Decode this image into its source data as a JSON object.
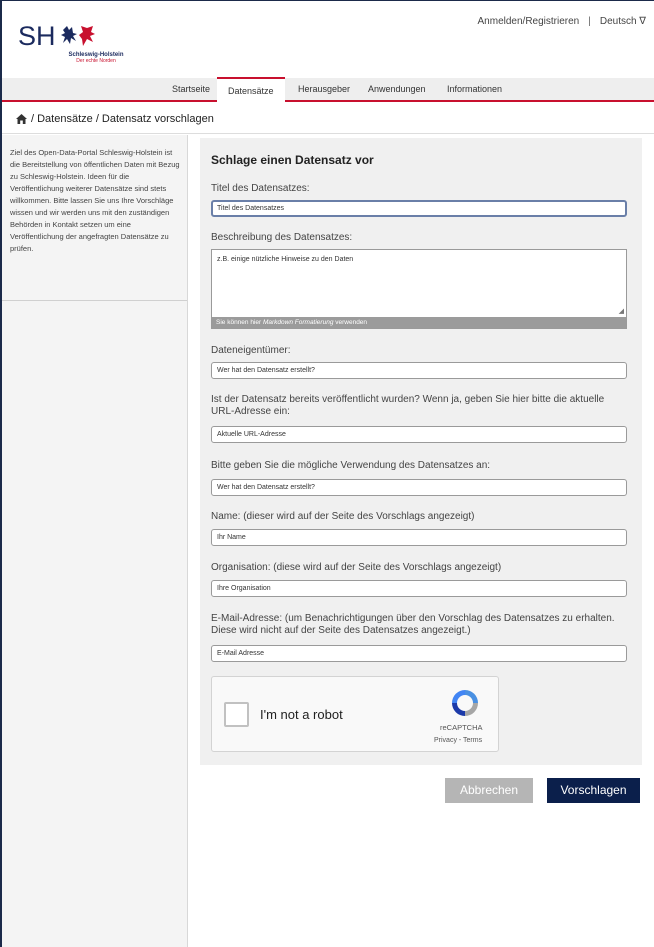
{
  "colors": {
    "brand_navy": "#0b1f4b",
    "accent_red": "#c8102e",
    "cancel_gray": "#b5b5b5"
  },
  "logo": {
    "initials": "SH",
    "name": "Schleswig-Holstein",
    "tagline": "Der echte Norden",
    "icon": "coat-of-arms-icon"
  },
  "topnav": {
    "login": "Anmelden/Registrieren",
    "separator": "|",
    "language": "Deutsch ∇"
  },
  "mainnav": [
    "Startseite",
    "Datensätze",
    "Herausgeber",
    "Anwendungen",
    "Informationen"
  ],
  "breadcrumb": {
    "icon": "home-icon",
    "text": "/ Datensätze / Datensatz vorschlagen"
  },
  "sidebar": {
    "text": "Ziel des Open-Data-Portal Schleswig-Holstein ist die Bereitstellung von öffentlichen Daten mit Bezug zu Schleswig-Holstein. Ideen für die Veröffentlichung weiterer Datensätze sind stets willkommen. Bitte lassen Sie uns Ihre Vorschläge wissen und wir werden uns mit den zuständigen Behörden in Kontakt setzen um eine Veröffentlichung der angefragten Datensätze zu prüfen."
  },
  "form": {
    "heading": "Schlage einen Datensatz vor",
    "title_label": "Titel des Datensatzes:",
    "title_placeholder": "Titel des Datensatzes",
    "description_label": "Beschreibung des Datensatzes:",
    "description_placeholder": "z.B. einige nützliche Hinweise zu den Daten",
    "markdown_hint_pre": "Sie können hier ",
    "markdown_hint_em": "Markdown Formatierung",
    "markdown_hint_post": " verwenden",
    "owner_label": "Dateneigentümer:",
    "owner_placeholder": "Wer hat den Datensatz erstellt?",
    "url_label": "Ist der Datensatz bereits veröffentlicht wurden? Wenn ja, geben Sie hier bitte die aktuelle URL-Adresse ein:",
    "url_placeholder": "Aktuelle URL-Adresse",
    "usage_label": "Bitte geben Sie die mögliche Verwendung des Datensatzes an:",
    "usage_placeholder": "Wer hat den Datensatz erstellt?",
    "name_label": "Name: (dieser wird auf der Seite des Vorschlags angezeigt)",
    "name_placeholder": "Ihr Name",
    "org_label": "Organisation: (diese wird auf der Seite des Vorschlags angezeigt)",
    "org_placeholder": "Ihre Organisation",
    "email_label": "E-Mail-Adresse: (um Benachrichtigungen über den Vorschlag des Datensatzes zu erhalten.  Diese wird nicht auf der Seite des Datensatzes angezeigt.)",
    "email_placeholder": "E-Mail Adresse"
  },
  "captcha": {
    "label": "I'm not a robot",
    "brand": "reCAPTCHA",
    "links": "Privacy - Terms",
    "icon": "recaptcha-icon"
  },
  "buttons": {
    "cancel": "Abbrechen",
    "submit": "Vorschlagen"
  }
}
